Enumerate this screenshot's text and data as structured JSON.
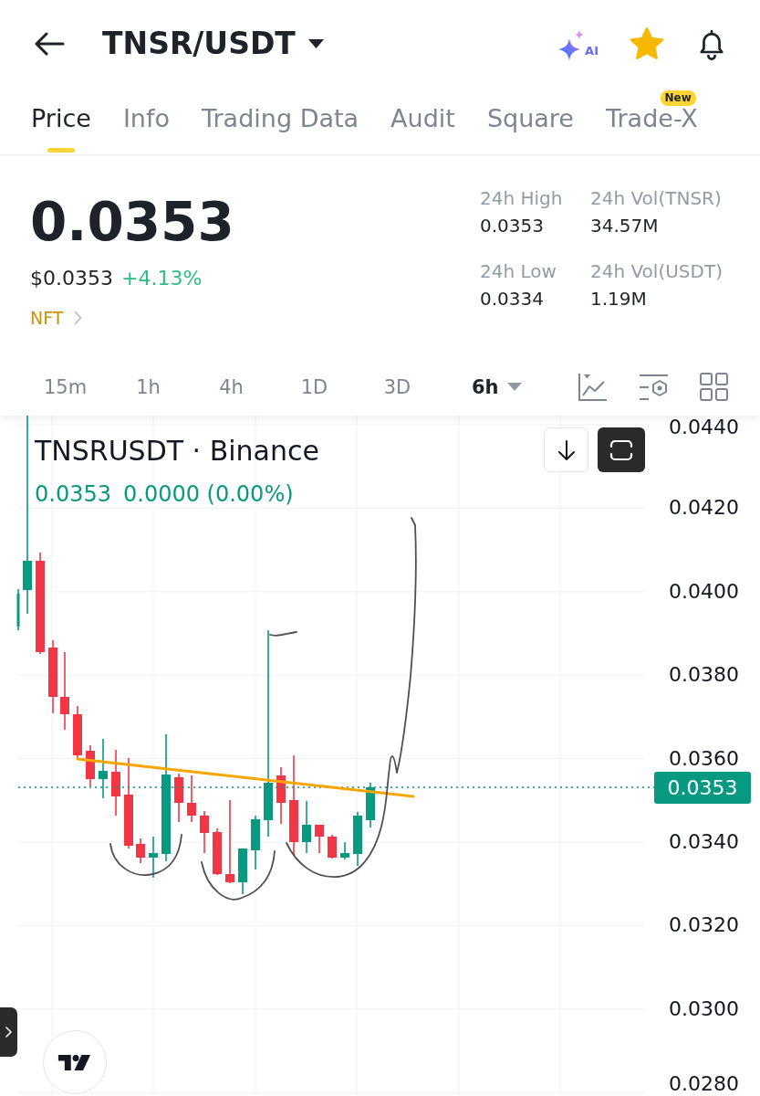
{
  "header": {
    "title": "TNSR/USDT",
    "ai_label": "AI",
    "favorited": true
  },
  "tabs": [
    {
      "label": "Price",
      "selected": true
    },
    {
      "label": "Info",
      "selected": false
    },
    {
      "label": "Trading Data",
      "selected": false
    },
    {
      "label": "Audit",
      "selected": false
    },
    {
      "label": "Square",
      "selected": false
    },
    {
      "label": "Trade-X",
      "selected": false,
      "badge": "New"
    }
  ],
  "price": {
    "last": "0.0353",
    "usd": "$0.0353",
    "change": "+4.13%",
    "tag": "NFT"
  },
  "stats": [
    {
      "label": "24h High",
      "value": "0.0353"
    },
    {
      "label": "24h Vol(TNSR)",
      "value": "34.57M"
    },
    {
      "label": "24h Low",
      "value": "0.0334"
    },
    {
      "label": "24h Vol(USDT)",
      "value": "1.19M"
    }
  ],
  "intervals": [
    {
      "label": "15m",
      "selected": false,
      "kind": "button"
    },
    {
      "label": "1h",
      "selected": false,
      "kind": "button"
    },
    {
      "label": "4h",
      "selected": false,
      "kind": "button"
    },
    {
      "label": "1D",
      "selected": false,
      "kind": "button"
    },
    {
      "label": "3D",
      "selected": false,
      "kind": "button"
    },
    {
      "label": "6h",
      "selected": true,
      "kind": "dropdown"
    }
  ],
  "chart": {
    "legend_title": "TNSRUSDT · Binance",
    "legend_price": "0.0353",
    "legend_change": "0.0000 (0.00%)",
    "price_axis": [
      "0.0440",
      "0.0420",
      "0.0400",
      "0.0380",
      "0.0360",
      "0.0340",
      "0.0320",
      "0.0300",
      "0.0280"
    ],
    "current_price": "0.0353"
  }
}
